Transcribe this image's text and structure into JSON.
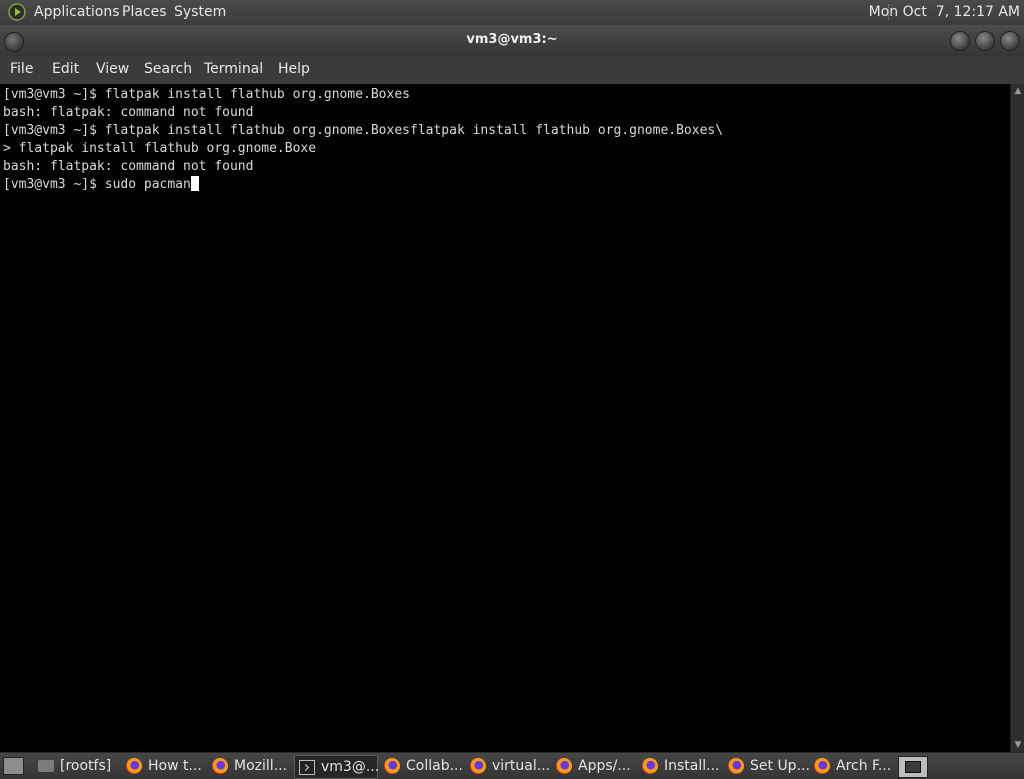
{
  "top_panel": {
    "applications": "Applications",
    "places": "Places",
    "system": "System",
    "clock": "Mon Oct  7, 12:17 AM"
  },
  "window": {
    "title": "vm3@vm3:~"
  },
  "menubar": [
    "File",
    "Edit",
    "View",
    "Search",
    "Terminal",
    "Help"
  ],
  "terminal": {
    "lines": [
      "[vm3@vm3 ~]$ flatpak install flathub org.gnome.Boxes",
      "bash: flatpak: command not found",
      "[vm3@vm3 ~]$ flatpak install flathub org.gnome.Boxesflatpak install flathub org.gnome.Boxes\\",
      "> flatpak install flathub org.gnome.Boxe",
      "bash: flatpak: command not found",
      "[vm3@vm3 ~]$ sudo pacman"
    ]
  },
  "taskbar": [
    {
      "label": "[rootfs]",
      "icon": "folder-icon"
    },
    {
      "label": "How t...",
      "icon": "firefox-icon"
    },
    {
      "label": "Mozill...",
      "icon": "firefox-icon"
    },
    {
      "label": "vm3@...",
      "icon": "terminal-icon"
    },
    {
      "label": "Collab...",
      "icon": "firefox-icon"
    },
    {
      "label": "virtual...",
      "icon": "firefox-icon"
    },
    {
      "label": "Apps/...",
      "icon": "firefox-icon"
    },
    {
      "label": "Install...",
      "icon": "firefox-icon"
    },
    {
      "label": "Set Up...",
      "icon": "firefox-icon"
    },
    {
      "label": "Arch F...",
      "icon": "firefox-icon"
    }
  ]
}
